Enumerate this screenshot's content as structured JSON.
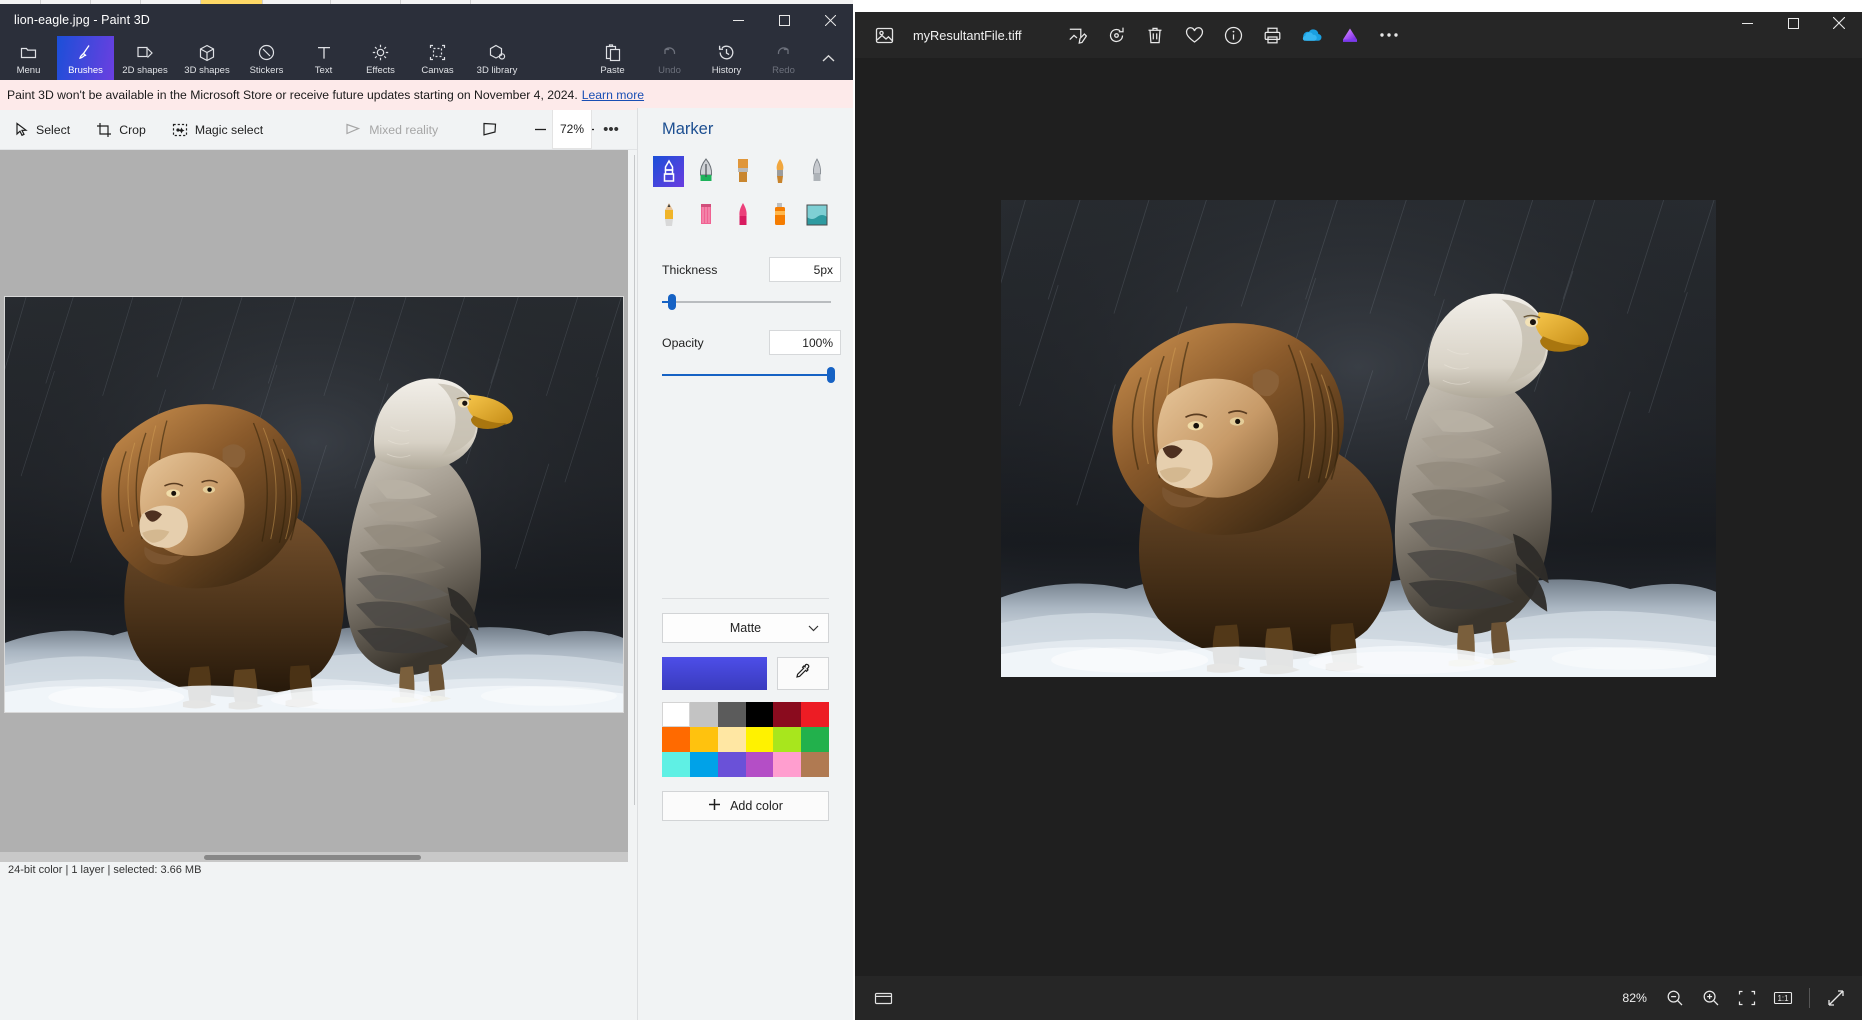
{
  "paint3d": {
    "title": "lion-eagle.jpg - Paint 3D",
    "window_controls": [
      {
        "name": "minimize",
        "glyph": "minimize-icon"
      },
      {
        "name": "maximize",
        "glyph": "maximize-icon"
      },
      {
        "name": "close",
        "glyph": "close-icon"
      }
    ],
    "ribbon": [
      {
        "label": "Menu",
        "icon": "folder-icon",
        "state": "normal"
      },
      {
        "label": "Brushes",
        "icon": "brush-icon",
        "state": "active"
      },
      {
        "label": "2D shapes",
        "icon": "2d-shapes-icon",
        "state": "normal"
      },
      {
        "label": "3D shapes",
        "icon": "3d-shapes-icon",
        "state": "normal"
      },
      {
        "label": "Stickers",
        "icon": "sticker-icon",
        "state": "normal"
      },
      {
        "label": "Text",
        "icon": "text-icon",
        "state": "normal"
      },
      {
        "label": "Effects",
        "icon": "effects-icon",
        "state": "normal"
      },
      {
        "label": "Canvas",
        "icon": "canvas-icon",
        "state": "normal"
      },
      {
        "label": "3D library",
        "icon": "3d-library-icon",
        "state": "normal"
      },
      {
        "label": "Paste",
        "icon": "paste-icon",
        "state": "normal"
      },
      {
        "label": "Undo",
        "icon": "undo-icon",
        "state": "disabled"
      },
      {
        "label": "History",
        "icon": "history-icon",
        "state": "normal"
      },
      {
        "label": "Redo",
        "icon": "redo-icon",
        "state": "disabled"
      }
    ],
    "banner": {
      "text": "Paint 3D won't be available in the Microsoft Store or receive future updates starting on November 4, 2024.",
      "link": "Learn more"
    },
    "toolbar": {
      "select": "Select",
      "crop": "Crop",
      "magic_select": "Magic select",
      "mixed_reality": "Mixed reality",
      "zoom_value": "72%",
      "more": "•••"
    },
    "panel": {
      "title": "Marker",
      "brushes": [
        {
          "name": "marker",
          "selected": true
        },
        {
          "name": "calligraphy-pen",
          "selected": false
        },
        {
          "name": "oil-brush",
          "selected": false
        },
        {
          "name": "watercolor",
          "selected": false
        },
        {
          "name": "eraser",
          "selected": false
        },
        {
          "name": "pencil",
          "selected": false
        },
        {
          "name": "crayon",
          "selected": false
        },
        {
          "name": "pixel-pen",
          "selected": false
        },
        {
          "name": "spray-can",
          "selected": false
        },
        {
          "name": "fill",
          "selected": false
        }
      ],
      "thickness_label": "Thickness",
      "thickness_value": "5px",
      "thickness_pct": 6,
      "opacity_label": "Opacity",
      "opacity_value": "100%",
      "opacity_pct": 100,
      "material_value": "Matte",
      "current_color": "#4d4ee8",
      "eyedropper": "eyedropper-icon",
      "swatches": [
        "#ffffff",
        "#c3c3c3",
        "#5b5b5b",
        "#000000",
        "#8a0b1e",
        "#ed1c24",
        "#ff6a00",
        "#ffc20e",
        "#ffe7a3",
        "#fff200",
        "#a8e61d",
        "#22b14c",
        "#5ff0e4",
        "#00a2e8",
        "#6a51d8",
        "#b44ec6",
        "#ff9ecf",
        "#b07a52"
      ],
      "add_color": "Add color"
    },
    "status": "24-bit color | 1 layer | selected: 3.66 MB"
  },
  "photos": {
    "filename": "myResultantFile.tiff",
    "app_icon": "photo-icon",
    "actions": [
      {
        "name": "edit-image-icon"
      },
      {
        "name": "rotate-icon"
      },
      {
        "name": "delete-icon"
      },
      {
        "name": "favorite-icon"
      },
      {
        "name": "info-icon"
      },
      {
        "name": "print-icon"
      },
      {
        "name": "onedrive-icon"
      },
      {
        "name": "designer-icon"
      },
      {
        "name": "more-icon"
      }
    ],
    "window_controls": [
      {
        "name": "minimize",
        "glyph": "minimize-icon"
      },
      {
        "name": "maximize",
        "glyph": "maximize-icon"
      },
      {
        "name": "close",
        "glyph": "close-icon"
      }
    ],
    "bottom": {
      "filmstrip": "filmstrip-icon",
      "zoom_label": "82%",
      "zoom_out": "zoom-out-icon",
      "zoom_in": "zoom-in-icon",
      "fit": "fit-to-window-icon",
      "actual": "actual-size-icon",
      "fullscreen": "fullscreen-icon"
    }
  },
  "artwork": {
    "description": "Digital painting of a lion standing beside a bald eagle on snowy rocks in rain"
  }
}
